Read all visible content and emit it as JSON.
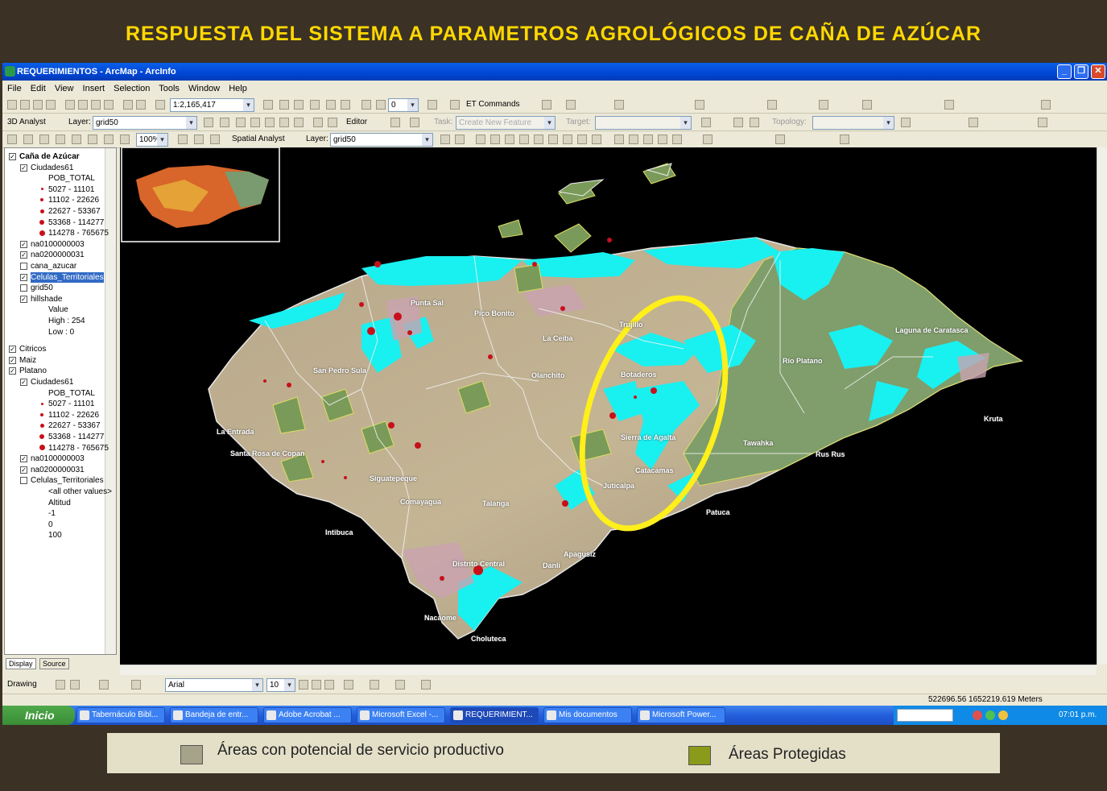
{
  "slide": {
    "title": "RESPUESTA DEL SISTEMA A PARAMETROS AGROLÓGICOS DE CAÑA DE AZÚCAR"
  },
  "window": {
    "title": "REQUERIMIENTOS - ArcMap - ArcInfo"
  },
  "menu": [
    "File",
    "Edit",
    "View",
    "Insert",
    "Selection",
    "Tools",
    "Window",
    "Help"
  ],
  "toolbar1": {
    "scale": "1:2,165,417",
    "zero_field": "0",
    "et_commands": "ET Commands"
  },
  "toolbar2": {
    "analyst": "3D Analyst",
    "layer_label": "Layer:",
    "layer_value": "grid50",
    "editor": "Editor",
    "task_label": "Task:",
    "task_value": "Create New Feature",
    "target_label": "Target:",
    "topology_label": "Topology:"
  },
  "toolbar3": {
    "zoom": "100%",
    "spatial_analyst": "Spatial Analyst",
    "layer_label": "Layer:",
    "layer_value": "grid50"
  },
  "toc": {
    "rows": [
      {
        "label": "Caña de Azúcar",
        "bold": true
      },
      {
        "label": "Ciudades61"
      },
      {
        "label": "POB_TOTAL"
      },
      {
        "label": "5027 - 11101"
      },
      {
        "label": "11102 - 22626"
      },
      {
        "label": "22627 - 53367"
      },
      {
        "label": "53368 - 114277"
      },
      {
        "label": "114278 - 765675"
      },
      {
        "label": "na0100000003"
      },
      {
        "label": "na0200000031"
      },
      {
        "label": "cana_azucar"
      },
      {
        "label": "Celulas_Territoriales"
      },
      {
        "label": "grid50"
      },
      {
        "label": "hillshade"
      },
      {
        "label": "Value"
      },
      {
        "label": "High : 254"
      },
      {
        "label": "Low : 0"
      },
      {
        "label": "Citricos"
      },
      {
        "label": "Maiz"
      },
      {
        "label": "Platano"
      },
      {
        "label": "Ciudades61"
      },
      {
        "label": "POB_TOTAL"
      },
      {
        "label": "5027 - 11101"
      },
      {
        "label": "11102 - 22626"
      },
      {
        "label": "22627 - 53367"
      },
      {
        "label": "53368 - 114277"
      },
      {
        "label": "114278 - 765675"
      },
      {
        "label": "na0100000003"
      },
      {
        "label": "na0200000031"
      },
      {
        "label": "Celulas_Territoriales"
      },
      {
        "label": "<all other values>"
      },
      {
        "label": "Altitud"
      },
      {
        "label": "-1"
      },
      {
        "label": "0"
      },
      {
        "label": "100"
      }
    ],
    "tabs": [
      "Display",
      "Source"
    ]
  },
  "map_labels": [
    "Punta Sal",
    "Pico Bonito",
    "La Ceiba",
    "Trujillo",
    "Laguna de Caratasca",
    "San Pedro Sula",
    "Olanchito",
    "Botaderos",
    "Río Platano",
    "La Entrada",
    "Santa Rosa de Copan",
    "Siguatepeque",
    "Comayagua",
    "Talanga",
    "Sierra de Agalta",
    "Catacamas",
    "Juticalpa",
    "Tawahka",
    "Rus Rus",
    "Kruta",
    "Intibuca",
    "Distrito Central",
    "Danli",
    "Apagusiz",
    "Patuca",
    "Nacaome",
    "Choluteca"
  ],
  "drawbar": {
    "drawing": "Drawing",
    "font": "Arial",
    "size": "10"
  },
  "status": {
    "coords": "522696.56  1652219.619 Meters"
  },
  "taskbar": {
    "start": "Inicio",
    "tasks": [
      "Tabernáculo Bibl...",
      "Bandeja de entr...",
      "Adobe Acrobat ...",
      "Microsoft Excel -...",
      "REQUERIMIENT...",
      "Mis documentos",
      "Microsoft Power..."
    ],
    "clock": "07:01 p.m."
  },
  "legend": {
    "items": [
      {
        "label": "Áreas con potencial de servicio productivo",
        "color": "#a5a389"
      },
      {
        "label": "Áreas Protegidas",
        "color": "#8a9a1a"
      }
    ]
  }
}
